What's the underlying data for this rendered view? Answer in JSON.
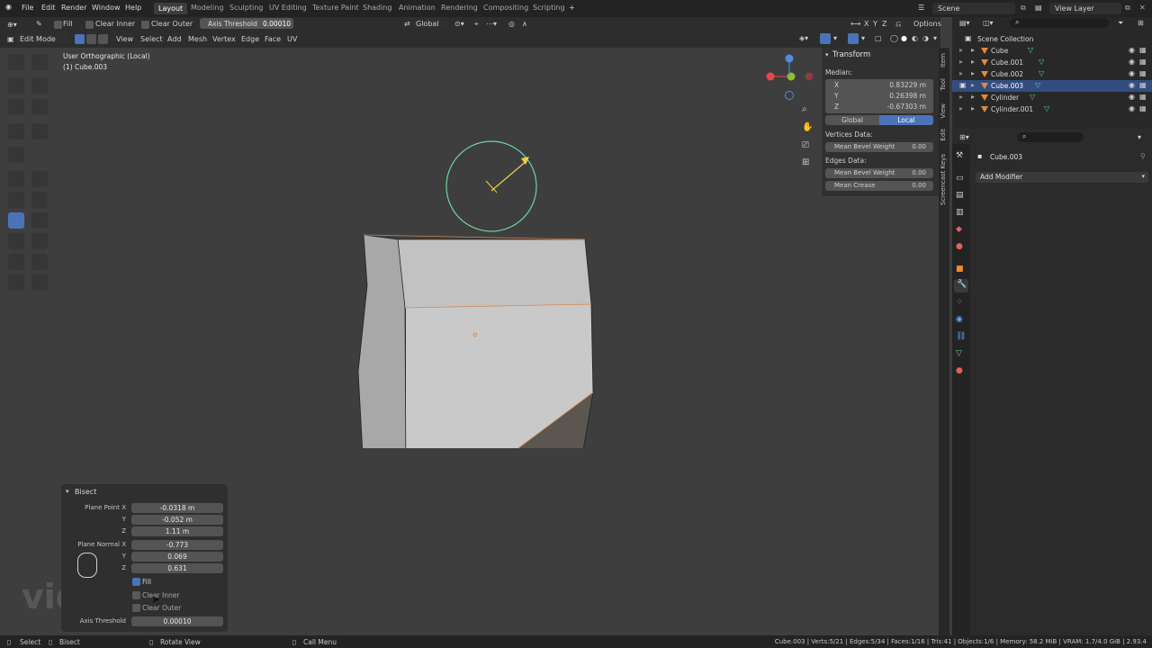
{
  "menus": [
    "File",
    "Edit",
    "Render",
    "Window",
    "Help"
  ],
  "workspaces": [
    "Layout",
    "Modeling",
    "Sculpting",
    "UV Editing",
    "Texture Paint",
    "Shading",
    "Animation",
    "Rendering",
    "Compositing",
    "Scripting"
  ],
  "workspace_add": "+",
  "scene": "Scene",
  "view_layer": "View Layer",
  "tool_header": {
    "fill": "Fill",
    "clear_inner": "Clear Inner",
    "clear_outer": "Clear Outer",
    "axis_threshold_label": "Axis Threshold",
    "axis_threshold_value": "0.00010",
    "orientation": "Global",
    "options": "Options",
    "axes": [
      "X",
      "Y",
      "Z"
    ]
  },
  "editor_header": {
    "mode": "Edit Mode",
    "menus": [
      "View",
      "Select",
      "Add",
      "Mesh",
      "Vertex",
      "Edge",
      "Face",
      "UV"
    ]
  },
  "viewport": {
    "view_name": "User Orthographic (Local)",
    "object_name": "(1) Cube.003"
  },
  "n_panel": {
    "title": "Transform",
    "median": "Median:",
    "x_label": "X",
    "x": "0.83229 m",
    "y_label": "Y",
    "y": "0.26398 m",
    "z_label": "Z",
    "z": "-0.67303 m",
    "global": "Global",
    "local": "Local",
    "vertices_data": "Vertices Data:",
    "mean_bevel_weight_label": "Mean Bevel Weight",
    "mean_bevel_weight_v": "0.00",
    "edges_data": "Edges Data:",
    "mean_bevel_weight_e": "0.00",
    "mean_crease_label": "Mean Crease",
    "mean_crease": "0.00",
    "tabs": [
      "Item",
      "Tool",
      "View",
      "Edit",
      "Screencast Keys"
    ]
  },
  "outliner": {
    "root": "Scene Collection",
    "items": [
      "Cube",
      "Cube.001",
      "Cube.002",
      "Cube.003",
      "Cylinder",
      "Cylinder.001"
    ],
    "selected": 3
  },
  "properties": {
    "object": "Cube.003",
    "add_modifier": "Add Modifier"
  },
  "redo_panel": {
    "title": "Bisect",
    "plane_point_x_label": "Plane Point X",
    "plane_point_x": "-0.0318 m",
    "y_label": "Y",
    "plane_point_y": "-0.052 m",
    "z_label": "Z",
    "plane_point_z": "1.11 m",
    "plane_normal_x_label": "Plane Normal X",
    "plane_normal_x": "-0.773",
    "plane_normal_y": "0.069",
    "plane_normal_z": "0.631",
    "fill": "Fill",
    "clear_inner": "Clear Inner",
    "clear_outer": "Clear Outer",
    "axis_threshold_label": "Axis Threshold",
    "axis_threshold": "0.00010"
  },
  "watermark": "videosmile",
  "status": {
    "select": "Select",
    "bisect": "Bisect",
    "rotate_view": "Rotate View",
    "call_menu": "Call Menu",
    "stats": "Cube.003 | Verts:5/21 | Edges:5/34 | Faces:1/16 | Tris:41 | Objects:1/6 | Memory: 58.2 MiB | VRAM: 1.7/4.0 GiB | 2.93.4"
  },
  "colors": {
    "accent": "#4b74b8",
    "orange": "#e08a3d",
    "gizmo_red": "#e8464c",
    "gizmo_green": "#8ac22c",
    "gizmo_blue": "#4c8fe0"
  }
}
